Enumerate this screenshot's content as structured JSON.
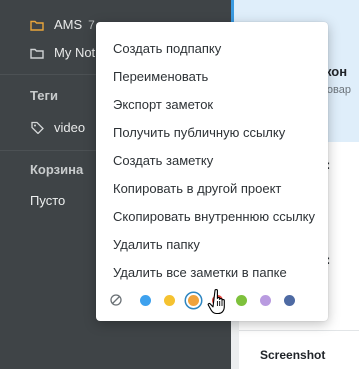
{
  "sidebar": {
    "folders": [
      {
        "name": "AMS",
        "count": "7",
        "icon": "folder-icon",
        "icon_color": "#e9a53b"
      },
      {
        "name": "My Not",
        "icon": "folder-icon",
        "icon_color": "#cfd2d4"
      }
    ],
    "tags_heading": "Теги",
    "tags": [
      {
        "name": "video",
        "icon": "tag-icon"
      }
    ],
    "trash_heading": "Корзина",
    "trash_text": "Пусто"
  },
  "content": {
    "note_title": "! кон",
    "note_subtitle": "Товар",
    "colon_1": ":",
    "colon_2": ":",
    "screenshot_label": "Screenshot"
  },
  "context_menu": {
    "items": [
      "Создать подпапку",
      "Переименовать",
      "Экспорт заметок",
      "Получить публичную ссылку",
      "Создать заметку",
      "Копировать в другой проект",
      "Скопировать внутреннюю ссылку",
      "Удалить папку",
      "Удалить все заметки в папке"
    ],
    "no_color_icon": "no-color-icon",
    "colors": [
      "#3da1ee",
      "#f5c230",
      "#f0a23c",
      "#e2453c",
      "#7ec13c",
      "#b99be0",
      "#4e6aa3"
    ],
    "selected_color": "#f0a23c"
  },
  "colors": {
    "sidebar_bg": "#3f4447",
    "accent": "#3a9ae0",
    "selected_note_bg": "#dfeefa"
  }
}
